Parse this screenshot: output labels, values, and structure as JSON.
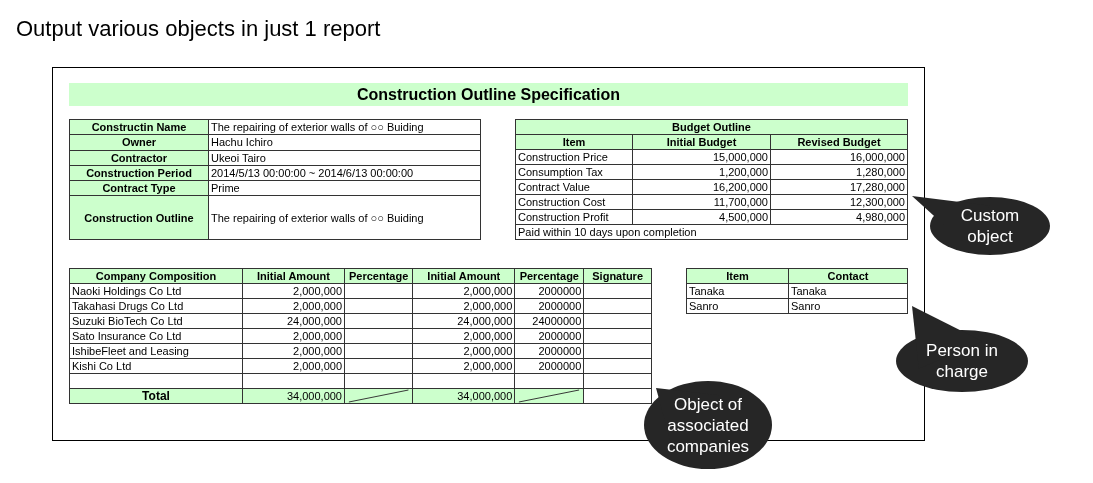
{
  "heading": "Output various objects in just 1 report",
  "report": {
    "title": "Construction Outline Specification",
    "outline": [
      {
        "label": "Constructin Name",
        "value": "The repairing of exterior walls of ○○ Buiding",
        "kind": "normal"
      },
      {
        "label": "Owner",
        "value": "Hachu Ichiro",
        "kind": "normal"
      },
      {
        "label": "Contractor",
        "value": "Ukeoi Tairo",
        "kind": "normal"
      },
      {
        "label": "Construction Period",
        "value": "2014/5/13 00:00:00 ~ 2014/6/13 00:00:00",
        "kind": "normal"
      },
      {
        "label": "Contract Type",
        "value": "Prime",
        "kind": "normal"
      },
      {
        "label": "Construction Outline",
        "value": "The repairing of exterior walls of ○○ Buiding",
        "kind": "tall"
      }
    ],
    "budget": {
      "title": "Budget Outline",
      "columns": [
        "Item",
        "Initial Budget",
        "Revised Budget"
      ],
      "rows": [
        [
          "Construction Price",
          "15,000,000",
          "16,000,000"
        ],
        [
          "Consumption Tax",
          "1,200,000",
          "1,280,000"
        ],
        [
          "Contract Value",
          "16,200,000",
          "17,280,000"
        ],
        [
          "Construction Cost",
          "11,700,000",
          "12,300,000"
        ],
        [
          "Construction Profit",
          "4,500,000",
          "4,980,000"
        ]
      ],
      "note": "Paid within 10 days upon completion"
    },
    "companies": {
      "columns": [
        "Company Composition",
        "Initial Amount",
        "Percentage",
        "Initial Amount",
        "Percentage",
        "Signature"
      ],
      "rows": [
        [
          "Naoki Holdings Co Ltd",
          "2,000,000",
          "",
          "2,000,000",
          "2000000",
          ""
        ],
        [
          "Takahasi Drugs Co Ltd",
          "2,000,000",
          "",
          "2,000,000",
          "2000000",
          ""
        ],
        [
          "Suzuki BioTech Co Ltd",
          "24,000,000",
          "",
          "24,000,000",
          "24000000",
          ""
        ],
        [
          "Sato Insurance Co Ltd",
          "2,000,000",
          "",
          "2,000,000",
          "2000000",
          ""
        ],
        [
          "IshibeFleet and Leasing",
          "2,000,000",
          "",
          "2,000,000",
          "2000000",
          ""
        ],
        [
          "Kishi Co Ltd",
          "2,000,000",
          "",
          "2,000,000",
          "2000000",
          ""
        ]
      ],
      "total": {
        "label": "Total",
        "initial_amount": "34,000,000",
        "initial_amount_2": "34,000,000"
      }
    },
    "contacts": {
      "columns": [
        "Item",
        "Contact"
      ],
      "rows": [
        [
          "Tanaka",
          "Tanaka"
        ],
        [
          "Sanro",
          "Sanro"
        ]
      ]
    }
  },
  "callouts": [
    {
      "text": "Custom\nobject"
    },
    {
      "text": "Person in\ncharge"
    },
    {
      "text": "Object of\nassociated\ncompanies"
    }
  ]
}
